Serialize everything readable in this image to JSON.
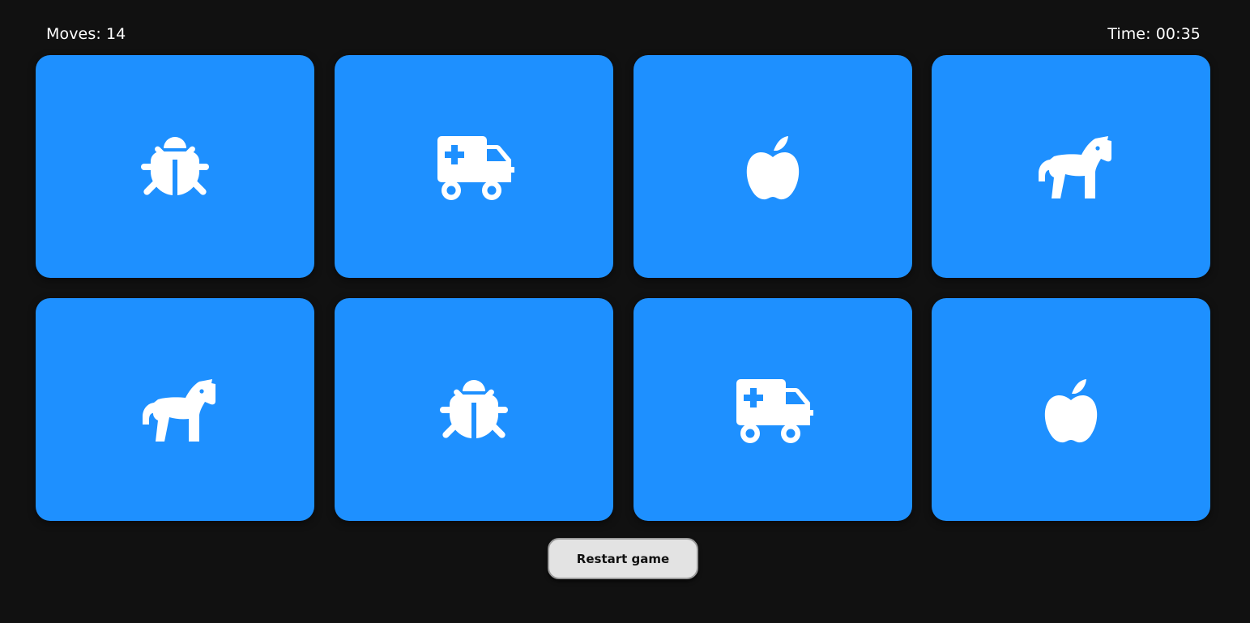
{
  "status": {
    "moves": "Moves: 14",
    "time": "Time: 00:35"
  },
  "board": {
    "card_color": "#1e90ff",
    "icon_color": "#ffffff",
    "cards": [
      {
        "icon": "bug-icon",
        "face_up": true
      },
      {
        "icon": "ambulance-icon",
        "face_up": true
      },
      {
        "icon": "apple-icon",
        "face_up": true
      },
      {
        "icon": "horse-icon",
        "face_up": true
      },
      {
        "icon": "horse-icon",
        "face_up": true
      },
      {
        "icon": "bug-icon",
        "face_up": true
      },
      {
        "icon": "ambulance-icon",
        "face_up": true
      },
      {
        "icon": "apple-icon",
        "face_up": true
      }
    ]
  },
  "controls": {
    "restart_label": "Restart game"
  },
  "colors": {
    "background": "#111111",
    "text": "#ffffff",
    "button_bg": "#e3e3e3"
  }
}
